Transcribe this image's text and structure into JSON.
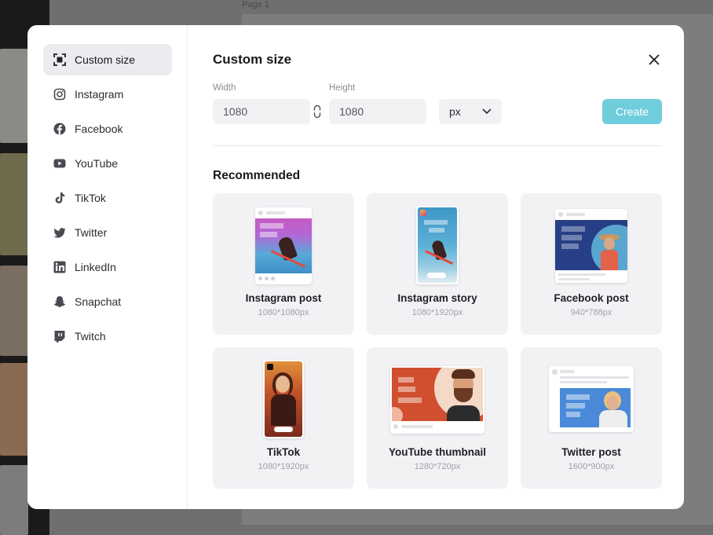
{
  "background": {
    "page_label": "Page 1"
  },
  "modal": {
    "title": "Custom size",
    "sidebar": {
      "items": [
        {
          "label": "Custom size",
          "icon": "crop-frame-icon",
          "active": true
        },
        {
          "label": "Instagram",
          "icon": "instagram-icon",
          "active": false
        },
        {
          "label": "Facebook",
          "icon": "facebook-icon",
          "active": false
        },
        {
          "label": "YouTube",
          "icon": "youtube-icon",
          "active": false
        },
        {
          "label": "TikTok",
          "icon": "tiktok-icon",
          "active": false
        },
        {
          "label": "Twitter",
          "icon": "twitter-icon",
          "active": false
        },
        {
          "label": "LinkedIn",
          "icon": "linkedin-icon",
          "active": false
        },
        {
          "label": "Snapchat",
          "icon": "snapchat-icon",
          "active": false
        },
        {
          "label": "Twitch",
          "icon": "twitch-icon",
          "active": false
        }
      ]
    },
    "size_form": {
      "width_label": "Width",
      "width_value": "1080",
      "height_label": "Height",
      "height_value": "1080",
      "unit": "px",
      "create_label": "Create"
    },
    "recommended": {
      "title": "Recommended",
      "cards": [
        {
          "name": "Instagram post",
          "dims": "1080*1080px"
        },
        {
          "name": "Instagram story",
          "dims": "1080*1920px"
        },
        {
          "name": "Facebook post",
          "dims": "940*788px"
        },
        {
          "name": "TikTok",
          "dims": "1080*1920px"
        },
        {
          "name": "YouTube thumbnail",
          "dims": "1280*720px"
        },
        {
          "name": "Twitter post",
          "dims": "1600*900px"
        }
      ]
    }
  },
  "colors": {
    "accent": "#6fcddc",
    "active_item_bg": "#ececf0",
    "card_bg": "#f2f2f5",
    "overlay": "#6b6b6b"
  }
}
